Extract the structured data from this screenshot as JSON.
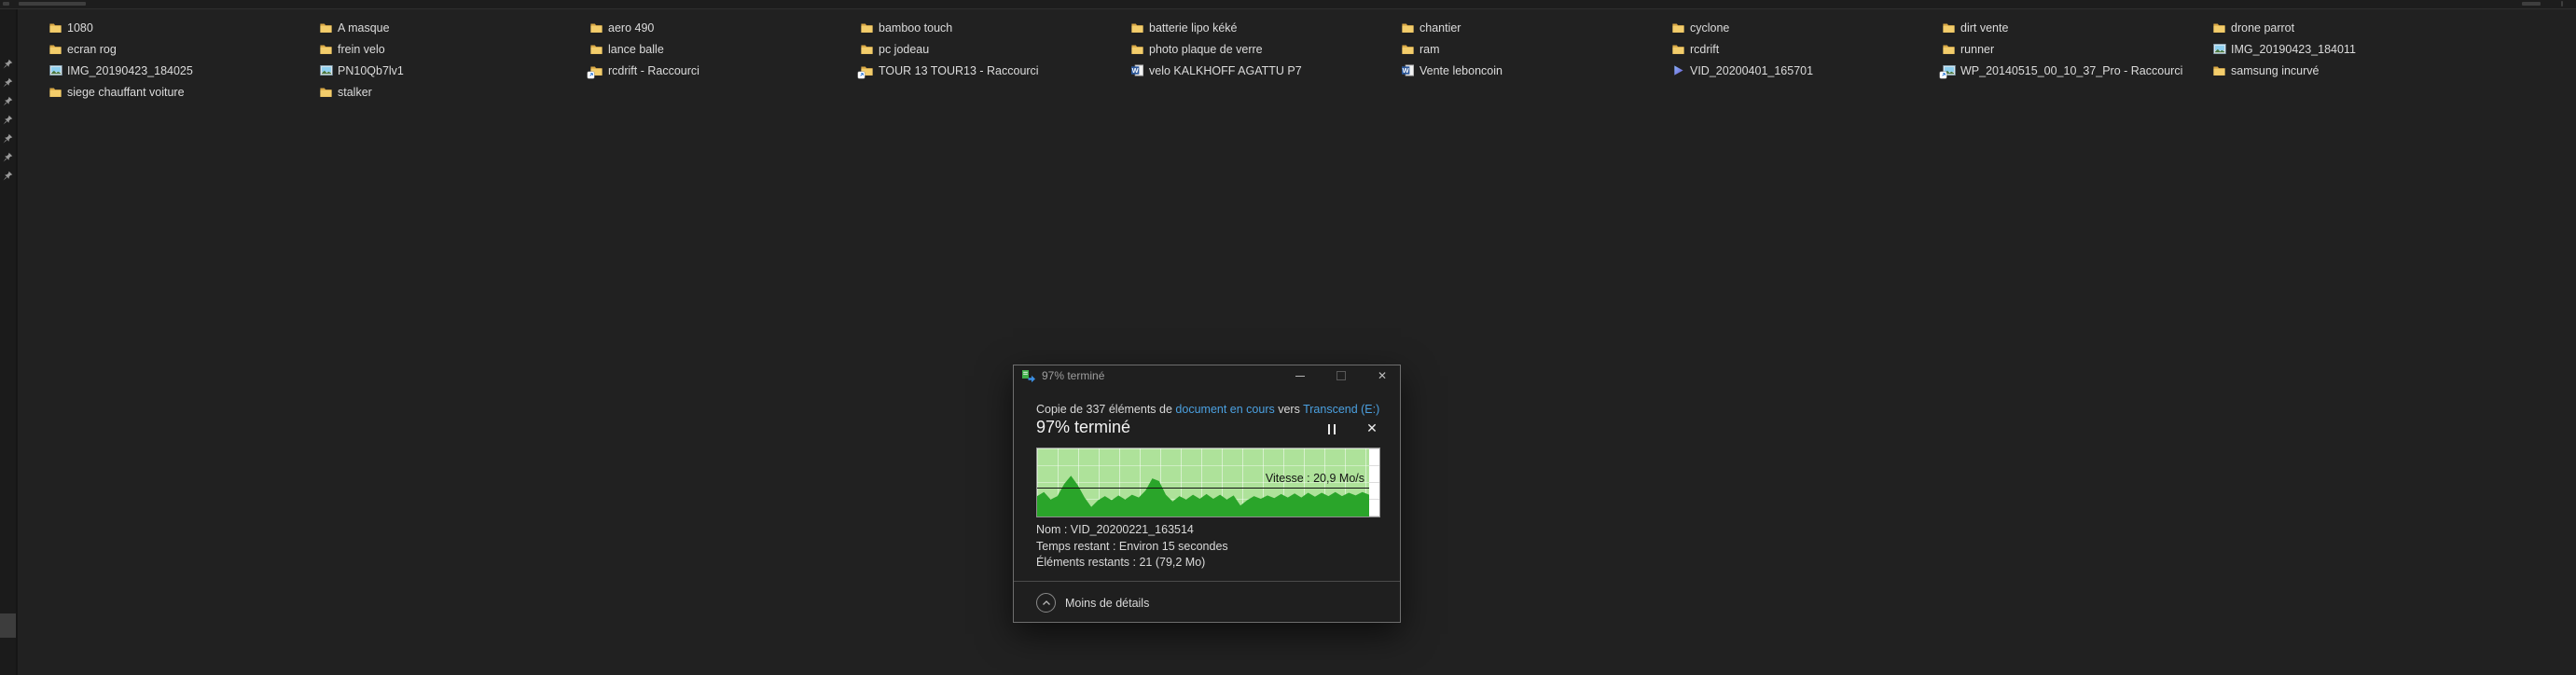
{
  "colors": {
    "page_bg": "#212121",
    "rail_bg": "#1b1b1b",
    "dialog_bg": "#1f1f1f",
    "link_blue": "#4ba0e0",
    "chart_green_light": "#aee29a",
    "chart_green_dark": "#2aa52a",
    "folder_yellow": "#f3cd6b"
  },
  "left_rail": {
    "pin_count": 7
  },
  "files": {
    "items": [
      {
        "label": "1080",
        "icon": "folder",
        "col": 0,
        "row": 0
      },
      {
        "label": "ecran rog",
        "icon": "folder",
        "col": 0,
        "row": 1
      },
      {
        "label": "IMG_20190423_184025",
        "icon": "image",
        "col": 0,
        "row": 2
      },
      {
        "label": "siege chauffant voiture",
        "icon": "folder",
        "col": 0,
        "row": 3
      },
      {
        "label": "A masque",
        "icon": "folder",
        "col": 1,
        "row": 0
      },
      {
        "label": "frein velo",
        "icon": "folder",
        "col": 1,
        "row": 1
      },
      {
        "label": "PN10Qb7lv1",
        "icon": "image",
        "col": 1,
        "row": 2
      },
      {
        "label": "stalker",
        "icon": "folder",
        "col": 1,
        "row": 3
      },
      {
        "label": "aero 490",
        "icon": "folder",
        "col": 2,
        "row": 0
      },
      {
        "label": "lance balle",
        "icon": "folder",
        "col": 2,
        "row": 1
      },
      {
        "label": "rcdrift - Raccourci",
        "icon": "folder-shortcut",
        "col": 2,
        "row": 2
      },
      {
        "label": "bamboo touch",
        "icon": "folder",
        "col": 3,
        "row": 0
      },
      {
        "label": "pc jodeau",
        "icon": "folder",
        "col": 3,
        "row": 1
      },
      {
        "label": "TOUR 13 TOUR13 - Raccourci",
        "icon": "folder-shortcut",
        "col": 3,
        "row": 2
      },
      {
        "label": "batterie lipo kéké",
        "icon": "folder",
        "col": 4,
        "row": 0
      },
      {
        "label": "photo plaque de verre",
        "icon": "folder",
        "col": 4,
        "row": 1
      },
      {
        "label": "velo KALKHOFF AGATTU P7",
        "icon": "word-doc",
        "col": 4,
        "row": 2
      },
      {
        "label": "chantier",
        "icon": "folder",
        "col": 5,
        "row": 0
      },
      {
        "label": "ram",
        "icon": "folder",
        "col": 5,
        "row": 1
      },
      {
        "label": "Vente leboncoin",
        "icon": "word-doc",
        "col": 5,
        "row": 2
      },
      {
        "label": "cyclone",
        "icon": "folder",
        "col": 6,
        "row": 0
      },
      {
        "label": "rcdrift",
        "icon": "folder",
        "col": 6,
        "row": 1
      },
      {
        "label": "VID_20200401_165701",
        "icon": "video",
        "col": 6,
        "row": 2
      },
      {
        "label": "dirt vente",
        "icon": "folder",
        "col": 7,
        "row": 0
      },
      {
        "label": "runner",
        "icon": "folder",
        "col": 7,
        "row": 1
      },
      {
        "label": "WP_20140515_00_10_37_Pro - Raccourci",
        "icon": "image-shortcut",
        "col": 7,
        "row": 2
      },
      {
        "label": "drone parrot",
        "icon": "folder",
        "col": 8,
        "row": 0
      },
      {
        "label": "IMG_20190423_184011",
        "icon": "image",
        "col": 8,
        "row": 1
      },
      {
        "label": "samsung incurvé",
        "icon": "folder",
        "col": 8,
        "row": 2
      }
    ]
  },
  "dialog": {
    "titlebar": {
      "title": "97% terminé"
    },
    "copy_line": {
      "prefix": "Copie de 337 éléments de ",
      "source": "document en cours",
      "connector": " vers ",
      "destination": "Transcend (E:)"
    },
    "progress_header": "97% terminé",
    "chart": {
      "percent_complete": 97,
      "speed_label": "Vitesse : 20,9 Mo/s",
      "speed_line_from_top_percent": 57,
      "sparkline": [
        0.3,
        0.36,
        0.25,
        0.3,
        0.48,
        0.6,
        0.46,
        0.28,
        0.14,
        0.24,
        0.3,
        0.24,
        0.31,
        0.25,
        0.32,
        0.28,
        0.38,
        0.56,
        0.52,
        0.32,
        0.22,
        0.3,
        0.25,
        0.32,
        0.26,
        0.33,
        0.26,
        0.32,
        0.25,
        0.31,
        0.16,
        0.24,
        0.3,
        0.26,
        0.31,
        0.27,
        0.33,
        0.28,
        0.34,
        0.28,
        0.35,
        0.29,
        0.35,
        0.3,
        0.36,
        0.3,
        0.35,
        0.31,
        0.36,
        0.32
      ]
    },
    "details": [
      {
        "label": "Nom",
        "value": "VID_20200221_163514"
      },
      {
        "label": "Temps restant",
        "value": "Environ 15 secondes"
      },
      {
        "label": "Éléments restants",
        "value": "21 (79,2 Mo)"
      }
    ],
    "footer": {
      "toggle_label": "Moins de détails"
    }
  }
}
